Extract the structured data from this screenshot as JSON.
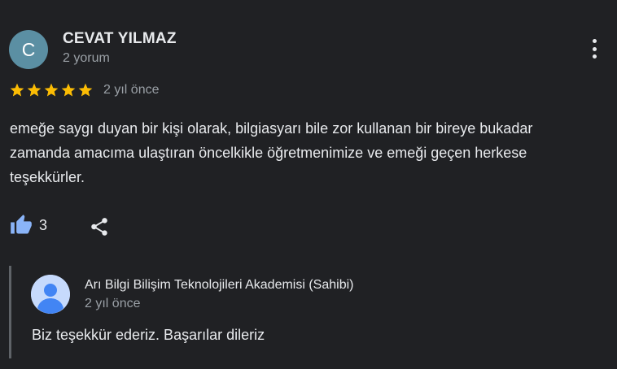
{
  "review": {
    "author": {
      "initial": "C",
      "name": "CEVAT YILMAZ",
      "meta": "2 yorum",
      "avatar_color": "#5b8fa3"
    },
    "rating": {
      "stars": 5,
      "max": 5,
      "color": "#fbbc04"
    },
    "date": "2 yıl önce",
    "text": "emeğe saygı duyan bir kişi olarak, bilgiasyarı bile zor kullanan bir bireye bukadar zamanda amacıma ulaştıran öncelkikle öğretmenimize ve emeği geçen herkese teşekkürler.",
    "likes": "3",
    "icons": {
      "like": "thumbs-up-icon",
      "share": "share-icon",
      "more": "more-vert-icon"
    }
  },
  "reply": {
    "owner_name": "Arı Bilgi Bilişim Teknolojileri Akademisi (Sahibi)",
    "date": "2 yıl önce",
    "text": "Biz teşekkür ederiz. Başarılar dileriz",
    "avatar_icon": "person-avatar-icon"
  },
  "colors": {
    "background": "#202124",
    "text": "#e8eaed",
    "muted": "#9aa0a6",
    "like_icon": "#8ab4f8"
  }
}
